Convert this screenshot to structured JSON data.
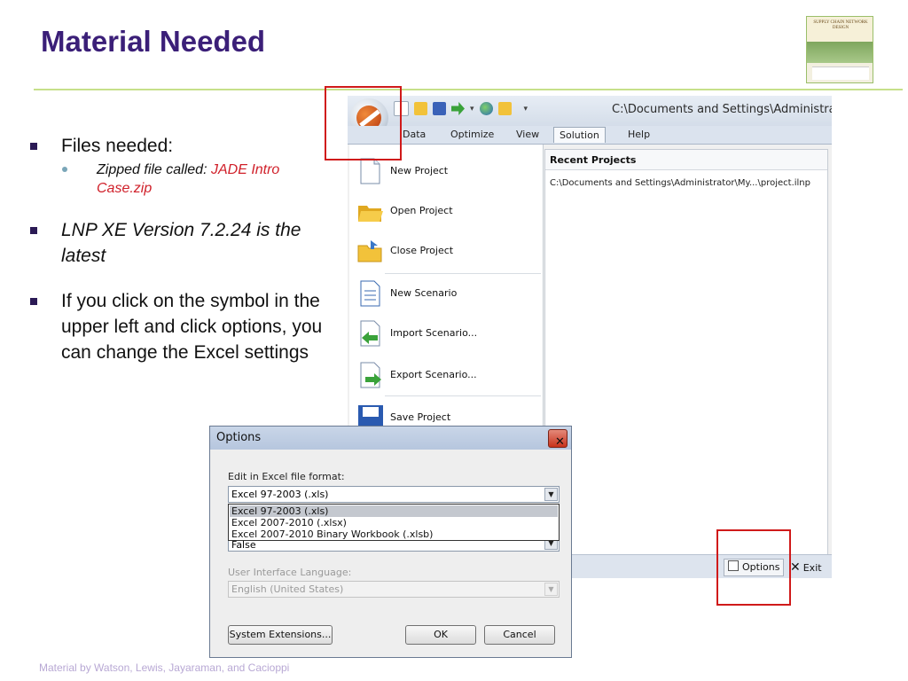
{
  "slide": {
    "title": "Material Needed",
    "footer": "Material by Watson, Lewis, Jayaraman, and Cacioppi",
    "book_cover_text": "SUPPLY CHAIN NETWORK DESIGN",
    "bullets": [
      {
        "text": "Files needed:",
        "sub": {
          "prefix": "Zipped file called:  ",
          "highlight": "JADE Intro Case.zip"
        }
      },
      {
        "text": "LNP XE Version 7.2.24 is the latest"
      },
      {
        "text": "If you click on the symbol in the upper left and click options, you can change the Excel settings"
      }
    ]
  },
  "app": {
    "window_title": "C:\\Documents and Settings\\Administrat",
    "menu_tabs": [
      "Data",
      "Optimize",
      "View",
      "Solution",
      "Help"
    ],
    "active_tab": "Solution",
    "file_menu": [
      {
        "label": "New Project",
        "icon": "new-document-icon"
      },
      {
        "label": "Open Project",
        "icon": "open-folder-icon"
      },
      {
        "label": "Close Project",
        "icon": "close-folder-icon"
      },
      {
        "label": "New Scenario",
        "icon": "scenario-document-icon"
      },
      {
        "label": "Import Scenario...",
        "icon": "import-arrow-icon"
      },
      {
        "label": "Export Scenario...",
        "icon": "export-arrow-icon"
      },
      {
        "label": "Save Project",
        "icon": "floppy-disk-icon"
      }
    ],
    "recent": {
      "title": "Recent Projects",
      "items": [
        "C:\\Documents and Settings\\Administrator\\My...\\project.ilnp"
      ]
    },
    "status": {
      "options_label": "Options",
      "exit_label": "Exit"
    }
  },
  "dialog": {
    "title": "Options",
    "excel_format_label": "Edit in Excel file format:",
    "excel_format_value": "Excel 97-2003 (.xls)",
    "excel_format_options": [
      "Excel 97-2003 (.xls)",
      "Excel 2007-2010  (.xlsx)",
      "Excel 2007-2010 Binary Workbook (.xlsb)"
    ],
    "hidden_field_value": "False",
    "language_label": "User Interface Language:",
    "language_value": "English (United States)",
    "system_extensions_label": "System Extensions...",
    "ok_label": "OK",
    "cancel_label": "Cancel"
  },
  "colors": {
    "title": "#3b1f78",
    "accent_red": "#d0202a",
    "highlight_box": "#d01a1a",
    "rule": "#c6e08a"
  }
}
